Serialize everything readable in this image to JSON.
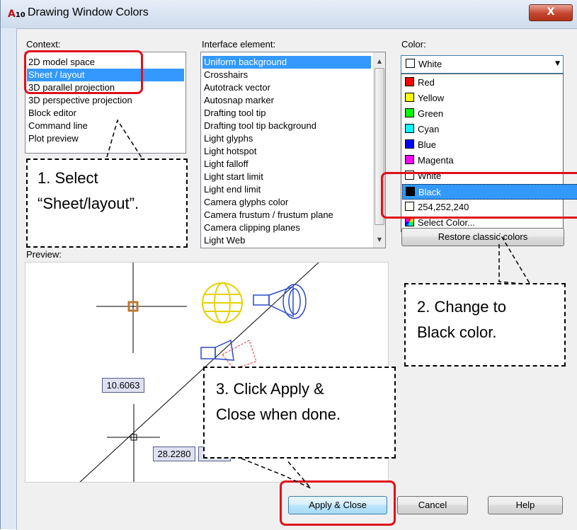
{
  "window": {
    "title": "Drawing Window Colors",
    "close_glyph": "X",
    "app_icon_text": "10"
  },
  "context": {
    "label": "Context:",
    "items": [
      "2D model space",
      "Sheet / layout",
      "3D parallel projection",
      "3D perspective projection",
      "Block editor",
      "Command line",
      "Plot preview"
    ],
    "selected_index": 1
  },
  "interface_element": {
    "label": "Interface element:",
    "items": [
      "Uniform background",
      "Crosshairs",
      "Autotrack vector",
      "Autosnap marker",
      "Drafting tool tip",
      "Drafting tool tip background",
      "Light glyphs",
      "Light hotspot",
      "Light falloff",
      "Light start limit",
      "Light end limit",
      "Camera glyphs color",
      "Camera frustum / frustum plane",
      "Camera clipping planes",
      "Light Web"
    ],
    "selected_index": 0
  },
  "color": {
    "label": "Color:",
    "selected": "White",
    "options": [
      {
        "label": "Red",
        "swatch": "#ff0000"
      },
      {
        "label": "Yellow",
        "swatch": "#ffff00"
      },
      {
        "label": "Green",
        "swatch": "#00ff00"
      },
      {
        "label": "Cyan",
        "swatch": "#00ffff"
      },
      {
        "label": "Blue",
        "swatch": "#0000ff"
      },
      {
        "label": "Magenta",
        "swatch": "#ff00ff"
      },
      {
        "label": "White",
        "swatch": "#ffffff"
      },
      {
        "label": "Black",
        "swatch": "#000000"
      },
      {
        "label": "254,252,240",
        "swatch": "#fefcf0"
      },
      {
        "label": "Select Color...",
        "swatch": "multicolor"
      }
    ],
    "highlighted_index": 7
  },
  "restore_button": "Restore classic colors",
  "preview": {
    "label": "Preview:",
    "dim1": "10.6063",
    "dim2": "28.2280"
  },
  "buttons": {
    "apply_close": "Apply & Close",
    "cancel": "Cancel",
    "help": "Help"
  },
  "callouts": {
    "step1_line1": "1. Select",
    "step1_line2": "“Sheet/layout”.",
    "step2_line1": "2. Change to",
    "step2_line2": "Black color.",
    "step3_line1": "3. Click Apply &",
    "step3_line2": "Close when done."
  },
  "colors": {
    "highlight": "#3399ff",
    "annotation_red": "#e0101a"
  }
}
